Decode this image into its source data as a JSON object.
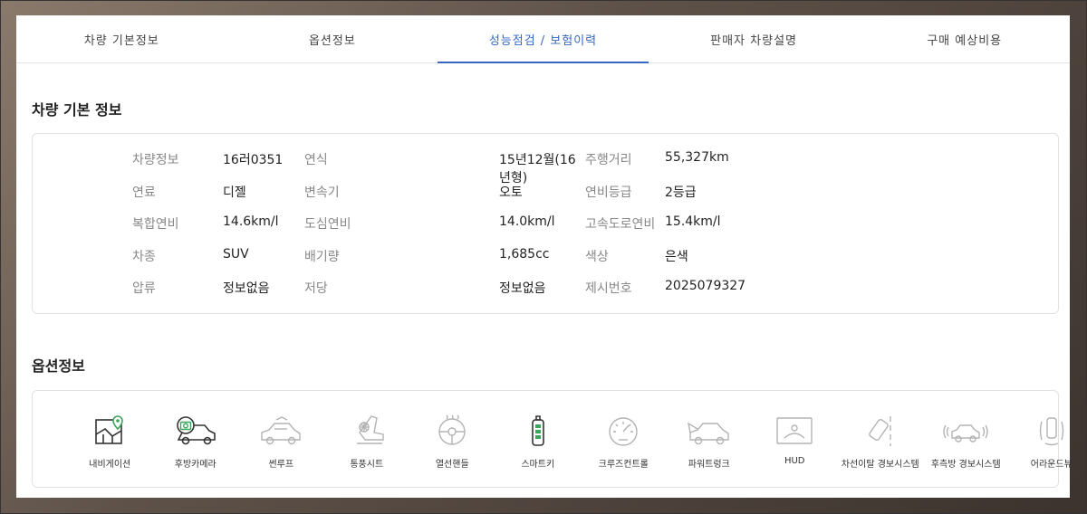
{
  "tabs": [
    {
      "label": "차량 기본정보",
      "active": false
    },
    {
      "label": "옵션정보",
      "active": false
    },
    {
      "label": "성능점검 / 보험이력",
      "active": true
    },
    {
      "label": "판매자 차량설명",
      "active": false
    },
    {
      "label": "구매 예상비용",
      "active": false
    }
  ],
  "spec": {
    "title": "차량 기본 정보",
    "rows": [
      [
        {
          "label": "차량정보",
          "value": "16러0351"
        },
        {
          "label": "연식",
          "value": "15년12월(16년형)"
        },
        {
          "label": "주행거리",
          "value": "55,327km"
        }
      ],
      [
        {
          "label": "연료",
          "value": "디젤"
        },
        {
          "label": "변속기",
          "value": "오토"
        },
        {
          "label": "연비등급",
          "value": "2등급"
        }
      ],
      [
        {
          "label": "복합연비",
          "value": "14.6km/l"
        },
        {
          "label": "도심연비",
          "value": "14.0km/l"
        },
        {
          "label": "고속도로연비",
          "value": "15.4km/l"
        }
      ],
      [
        {
          "label": "차종",
          "value": "SUV"
        },
        {
          "label": "배기량",
          "value": "1,685cc"
        },
        {
          "label": "색상",
          "value": "은색"
        }
      ],
      [
        {
          "label": "압류",
          "value": "정보없음"
        },
        {
          "label": "저당",
          "value": "정보없음"
        },
        {
          "label": "제시번호",
          "value": "2025079327"
        }
      ]
    ]
  },
  "options": {
    "title": "옵션정보",
    "items": [
      {
        "label": "내비게이션",
        "icon": "navigation-icon",
        "on": true
      },
      {
        "label": "후방카메라",
        "icon": "rear-camera-icon",
        "on": true
      },
      {
        "label": "썬루프",
        "icon": "sunroof-icon",
        "on": false
      },
      {
        "label": "통풍시트",
        "icon": "ventilated-seat-icon",
        "on": false
      },
      {
        "label": "열선핸들",
        "icon": "heated-steering-icon",
        "on": false
      },
      {
        "label": "스마트키",
        "icon": "smart-key-icon",
        "on": true
      },
      {
        "label": "크루즈컨트롤",
        "icon": "cruise-control-icon",
        "on": false
      },
      {
        "label": "파워트렁크",
        "icon": "power-trunk-icon",
        "on": false
      },
      {
        "label": "HUD",
        "icon": "hud-icon",
        "on": false
      },
      {
        "label": "차선이탈 경보시스템",
        "icon": "lane-departure-icon",
        "on": false
      },
      {
        "label": "후측방 경보시스템",
        "icon": "blind-spot-icon",
        "on": false
      },
      {
        "label": "어라운드뷰",
        "icon": "around-view-icon",
        "on": false
      }
    ],
    "colors": {
      "on_dark": "#333333",
      "on_accent": "#3aa65a",
      "off": "#b3b3b3"
    }
  }
}
